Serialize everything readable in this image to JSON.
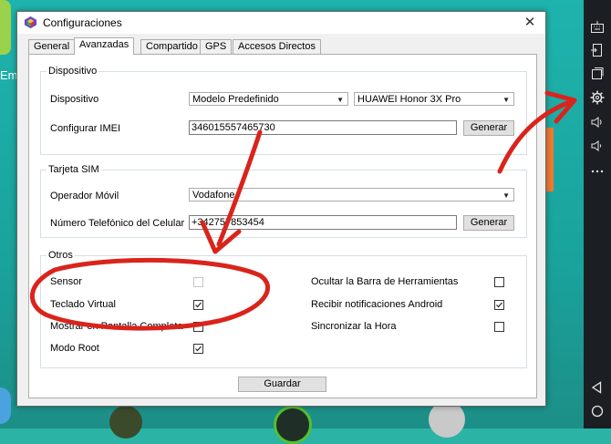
{
  "desktop": {
    "label": "Emu"
  },
  "dialog": {
    "title": "Configuraciones",
    "tabs": [
      {
        "label": "General"
      },
      {
        "label": "Avanzadas"
      },
      {
        "label": "Compartido"
      },
      {
        "label": "GPS"
      },
      {
        "label": "Accesos Directos"
      }
    ],
    "dispositivo": {
      "group_title": "Dispositivo",
      "device_label": "Dispositivo",
      "model_value": "Modelo Predefinido",
      "brand_value": "HUAWEI Honor 3X Pro",
      "imei_label": "Configurar IMEI",
      "imei_value": "346015557465730",
      "generate_label": "Generar"
    },
    "sim": {
      "group_title": "Tarjeta SIM",
      "operator_label": "Operador Móvil",
      "operator_value": "Vodafone",
      "phone_label": "Número Telefónico del Celular",
      "phone_value": "+342757853454",
      "generate_label": "Generar"
    },
    "otros": {
      "group_title": "Otros",
      "left": [
        {
          "label": "Sensor",
          "checked": false,
          "disabled": true
        },
        {
          "label": "Teclado Virtual",
          "checked": true
        },
        {
          "label": "Mostrar en Pantalla Completa",
          "checked": false
        },
        {
          "label": "Modo Root",
          "checked": true
        }
      ],
      "right": [
        {
          "label": "Ocultar la Barra de Herramientas",
          "checked": false
        },
        {
          "label": "Recibir notificaciones Android",
          "checked": true
        },
        {
          "label": "Sincronizar la Hora",
          "checked": false
        }
      ]
    },
    "save_label": "Guardar"
  },
  "colors": {
    "annotation": "#d9241c",
    "teal_bg": "#1fb3ad"
  },
  "sidebar_icons": [
    "keyboard-icon",
    "screen-rotate-icon",
    "window-icon",
    "settings-gear-icon",
    "volume-up-icon",
    "volume-down-icon",
    "more-icon",
    "back-icon",
    "home-icon"
  ]
}
